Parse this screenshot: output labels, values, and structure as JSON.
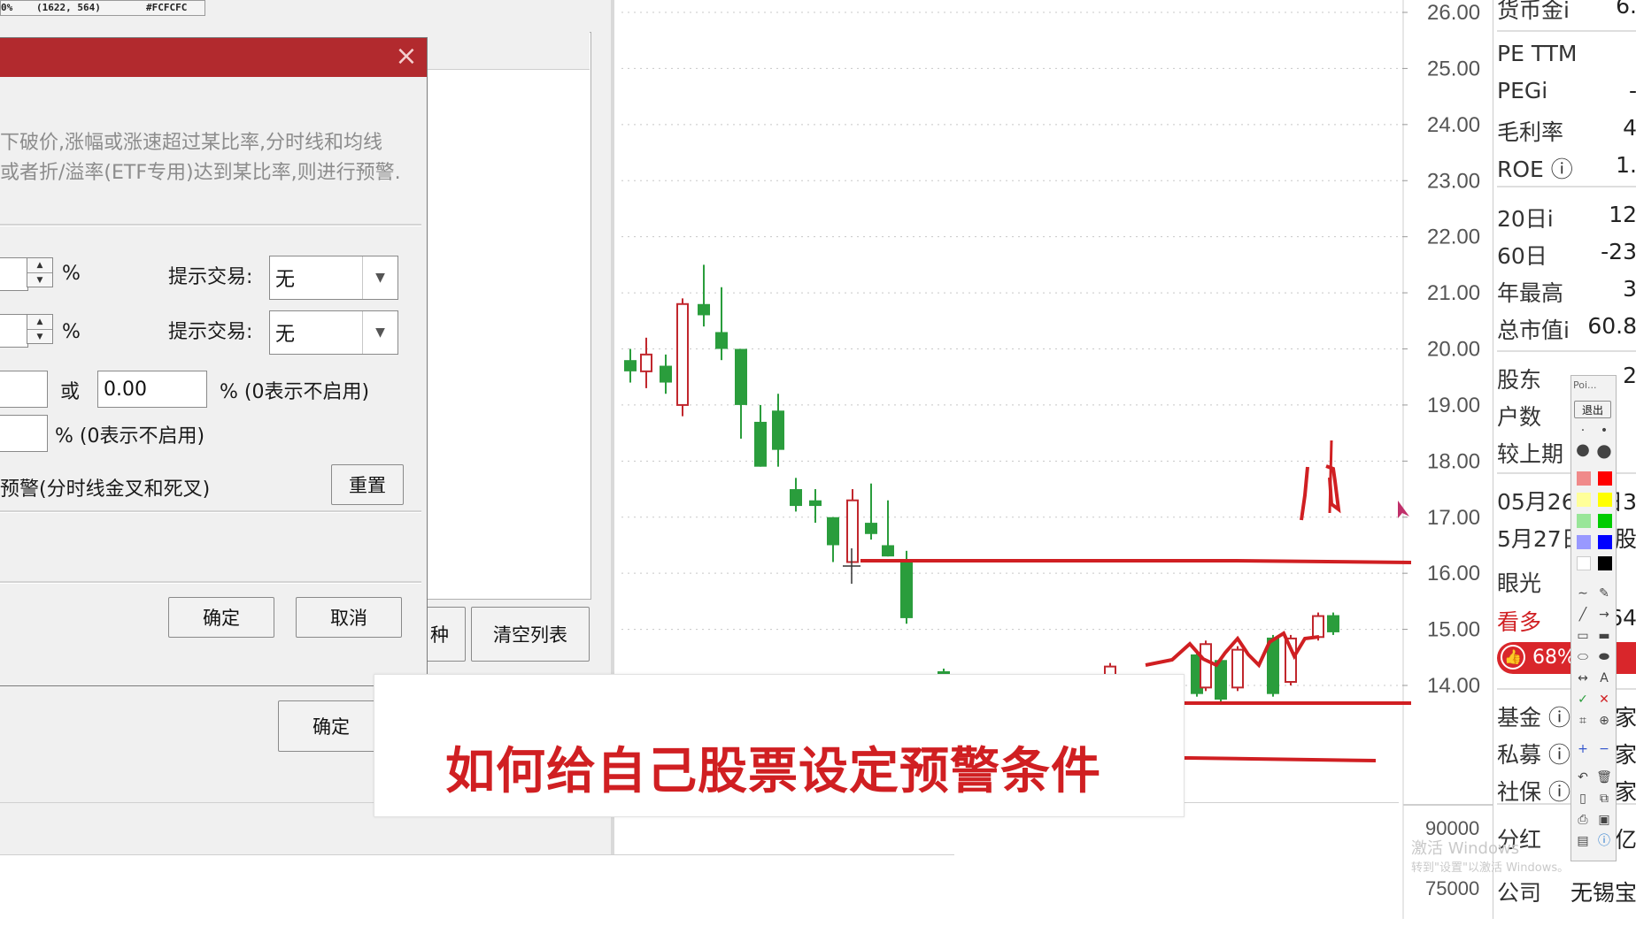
{
  "toolbar_readout": {
    "percent": "0%",
    "coords": "(1622,  564)",
    "color": "#FCFCFC"
  },
  "dialog": {
    "description_line1": "下破价,涨幅或涨速超过某比率,分时线和均线",
    "description_line2": "或者折/溢率(ETF专用)达到某比率,则进行预警.",
    "row1": {
      "unit": "%",
      "label": "提示交易:",
      "select_value": "无"
    },
    "row2": {
      "unit": "%",
      "label": "提示交易:",
      "select_value": "无"
    },
    "row3": {
      "or_label": "或",
      "value": "0.00",
      "suffix": "% (0表示不启用)"
    },
    "row4": {
      "suffix": "% (0表示不启用)"
    },
    "row5": {
      "label": "预警(分时线金叉和死叉)",
      "reset_button": "重置"
    },
    "ok_button": "确定",
    "cancel_button": "取消",
    "close_icon": "×"
  },
  "list_panel": {
    "partial_button": "种",
    "clear_button": "清空列表",
    "outer_ok_button": "确定"
  },
  "banner": {
    "title": "如何给自己股票设定预警条件"
  },
  "chart_data": {
    "type": "candlestick",
    "title": "",
    "y_ticks": [
      "26.00",
      "25.00",
      "24.00",
      "23.00",
      "22.00",
      "21.00",
      "20.00",
      "19.00",
      "18.00",
      "17.00",
      "16.00",
      "15.00",
      "14.00"
    ],
    "volume_ticks": [
      "90000",
      "75000"
    ],
    "candles": [
      {
        "o": 19.8,
        "h": 20.0,
        "l": 19.4,
        "c": 19.6,
        "dir": "down"
      },
      {
        "o": 19.6,
        "h": 20.2,
        "l": 19.3,
        "c": 19.9,
        "dir": "up"
      },
      {
        "o": 19.7,
        "h": 19.9,
        "l": 19.2,
        "c": 19.4,
        "dir": "down"
      },
      {
        "o": 19.0,
        "h": 20.9,
        "l": 18.8,
        "c": 20.8,
        "dir": "up"
      },
      {
        "o": 20.8,
        "h": 21.5,
        "l": 20.4,
        "c": 20.6,
        "dir": "down"
      },
      {
        "o": 20.3,
        "h": 21.1,
        "l": 19.8,
        "c": 20.0,
        "dir": "down"
      },
      {
        "o": 20.0,
        "h": 20.0,
        "l": 18.4,
        "c": 19.0,
        "dir": "down"
      },
      {
        "o": 18.7,
        "h": 19.0,
        "l": 17.9,
        "c": 17.9,
        "dir": "down"
      },
      {
        "o": 18.9,
        "h": 19.2,
        "l": 17.9,
        "c": 18.2,
        "dir": "down"
      },
      {
        "o": 17.5,
        "h": 17.7,
        "l": 17.1,
        "c": 17.2,
        "dir": "down"
      },
      {
        "o": 17.3,
        "h": 17.5,
        "l": 16.9,
        "c": 17.2,
        "dir": "down"
      },
      {
        "o": 17.0,
        "h": 17.0,
        "l": 16.2,
        "c": 16.5,
        "dir": "down"
      },
      {
        "o": 16.2,
        "h": 17.5,
        "l": 16.2,
        "c": 17.3,
        "dir": "up"
      },
      {
        "o": 16.9,
        "h": 17.6,
        "l": 16.6,
        "c": 16.7,
        "dir": "down"
      },
      {
        "o": 16.5,
        "h": 17.3,
        "l": 16.3,
        "c": 16.3,
        "dir": "down"
      },
      {
        "o": 16.2,
        "h": 16.4,
        "l": 15.1,
        "c": 15.2,
        "dir": "down"
      }
    ],
    "annotations": [
      "red horizontal line near 16.2",
      "red horizontal line near 13.7",
      "red horizontal line near 12.7",
      "red wave scribble 14.2–15.0",
      "red mark near 17.0–18.3"
    ]
  },
  "info_panel": {
    "rows": [
      {
        "label": "货币金i",
        "value": "6."
      },
      {
        "label": "PE TTM",
        "value": ""
      },
      {
        "label": "PEGi",
        "value": "-"
      },
      {
        "label": "毛利率",
        "value": "4"
      },
      {
        "label": "ROE ⓘ",
        "value": "1."
      },
      {
        "label": "20日i",
        "value": "12"
      },
      {
        "label": "60日",
        "value": "-23"
      },
      {
        "label": "年最高",
        "value": "3"
      },
      {
        "label": "总市值i",
        "value": "60.8"
      },
      {
        "label": "股东",
        "value": "2"
      },
      {
        "label": "户数",
        "value": ""
      },
      {
        "label": "较上期",
        "value": ""
      },
      {
        "label": "05月26",
        "value": "日3"
      },
      {
        "label": "5月27日",
        "value": "股"
      },
      {
        "label": "眼光",
        "value": ""
      },
      {
        "label": "看多",
        "value": "64"
      },
      {
        "label": "68%",
        "value": ""
      },
      {
        "label": "基金 ⓘ",
        "value": "家"
      },
      {
        "label": "私募 ⓘ",
        "value": "家"
      },
      {
        "label": "社保 ⓘ",
        "value": "家"
      },
      {
        "label": "分红",
        "value": "亿"
      },
      {
        "label": "公司",
        "value": "无锡宝"
      }
    ]
  },
  "draw_toolbar": {
    "title": "Poi...",
    "exit_button": "退出"
  },
  "watermark": {
    "line1": "激活 Windows",
    "line2": "转到\"设置\"以激活 Windows。"
  },
  "colors": {
    "up": "#c1272d",
    "down": "#2a9d3c",
    "alert_red": "#d01f22",
    "dialog_title": "#b22a2e"
  }
}
